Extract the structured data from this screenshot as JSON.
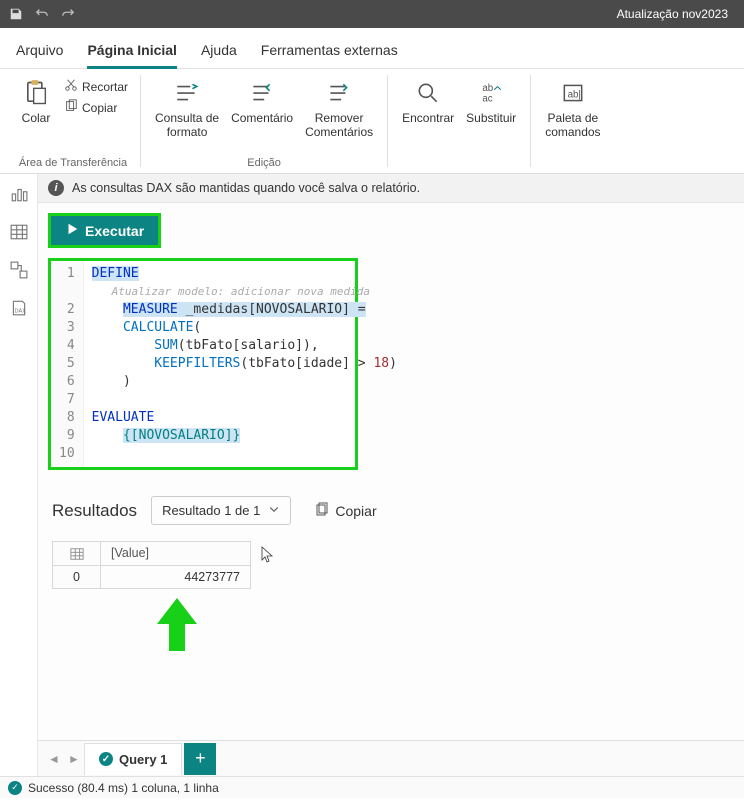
{
  "titlebar": {
    "project_name": "Atualização nov2023"
  },
  "menubar": {
    "items": [
      {
        "label": "Arquivo"
      },
      {
        "label": "Página Inicial"
      },
      {
        "label": "Ajuda"
      },
      {
        "label": "Ferramentas externas"
      }
    ]
  },
  "ribbon": {
    "paste_label": "Colar",
    "cut_label": "Recortar",
    "copy_label": "Copiar",
    "clipboard_group": "Área de Transferência",
    "format_query_label": "Consulta de\nformato",
    "comment_label": "Comentário",
    "remove_comments_label": "Remover\nComentários",
    "edit_group": "Edição",
    "find_label": "Encontrar",
    "replace_label": "Substituir",
    "command_palette_label": "Paleta de\ncomandos"
  },
  "infobar": {
    "text": "As consultas DAX são mantidas quando você salva o relatório."
  },
  "toolbar": {
    "execute_label": "Executar"
  },
  "editor": {
    "line_numbers": [
      "1",
      "2",
      "3",
      "4",
      "5",
      "6",
      "7",
      "8",
      "9",
      "10"
    ],
    "hint": "Atualizar modelo: adicionar nova medida",
    "lines": {
      "l1_kw": "DEFINE",
      "l2_pre": "    ",
      "l2_kw": "MEASURE",
      "l2_rest": " _medidas[NOVOSALARIO] =",
      "l3_pre": "    ",
      "l3_fn": "CALCULATE",
      "l3_rest": "(",
      "l4_pre": "        ",
      "l4_fn": "SUM",
      "l4_rest1": "(tbFato[salario]),",
      "l5_pre": "        ",
      "l5_fn": "KEEPFILTERS",
      "l5_rest1": "(tbFato[idade] > ",
      "l5_num": "18",
      "l5_rest2": ")",
      "l6": "    )",
      "l8_kw": "EVALUATE",
      "l9_pre": "    ",
      "l9_val": "{[NOVOSALARIO]}"
    }
  },
  "results": {
    "title": "Resultados",
    "dropdown": "Resultado 1 de 1",
    "copy_label": "Copiar",
    "col_header": "[Value]",
    "rows": [
      {
        "index": "0",
        "value": "44273777"
      }
    ]
  },
  "tabs": {
    "query1": "Query 1"
  },
  "status": {
    "text": "Sucesso (80.4 ms) 1 coluna, 1 linha"
  }
}
